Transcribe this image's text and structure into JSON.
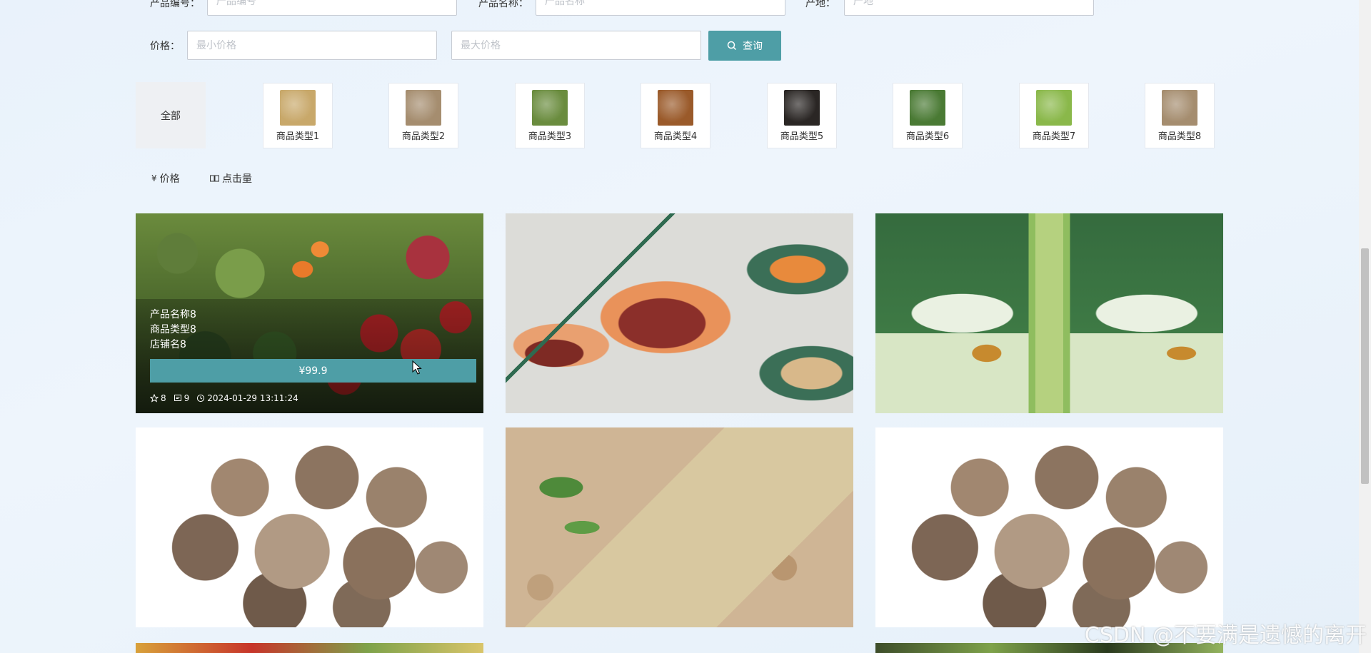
{
  "search": {
    "product_code_label": "产品编号：",
    "product_code_placeholder": "产品编号",
    "product_name_label": "产品名称：",
    "product_name_placeholder": "产品名称",
    "origin_label": "产地：",
    "origin_placeholder": "产地",
    "price_label": "价格：",
    "min_price_placeholder": "最小价格",
    "max_price_placeholder": "最大价格",
    "query_button": "查询"
  },
  "categories": {
    "all_label": "全部",
    "items": [
      {
        "label": "商品类型1",
        "color": "#c8a86a"
      },
      {
        "label": "商品类型2",
        "color": "#a58d6f"
      },
      {
        "label": "商品类型3",
        "color": "#6a8c3e"
      },
      {
        "label": "商品类型4",
        "color": "#9a5a2a"
      },
      {
        "label": "商品类型5",
        "color": "#2a2624"
      },
      {
        "label": "商品类型6",
        "color": "#4a7a34"
      },
      {
        "label": "商品类型7",
        "color": "#8ab84a"
      },
      {
        "label": "商品类型8",
        "color": "#a58d6f"
      }
    ]
  },
  "sort": {
    "price_label": "价格",
    "price_icon": "¥",
    "clicks_label": "点击量",
    "clicks_icon": "book-icon"
  },
  "products": [
    {
      "image": "vegetables",
      "name": "产品名称8",
      "type": "商品类型8",
      "shop": "店铺名8",
      "price": "¥99.9",
      "stars": "8",
      "clicks": "9",
      "time": "2024-01-29 13:11:24"
    },
    {
      "image": "organic-dates-packages"
    },
    {
      "image": "free-range-chicken-bags"
    },
    {
      "image": "shiitake-mushrooms"
    },
    {
      "image": "broad-beans"
    },
    {
      "image": "shiitake-mushrooms"
    }
  ],
  "watermark": "CSDN @不要满是遗憾的离开"
}
